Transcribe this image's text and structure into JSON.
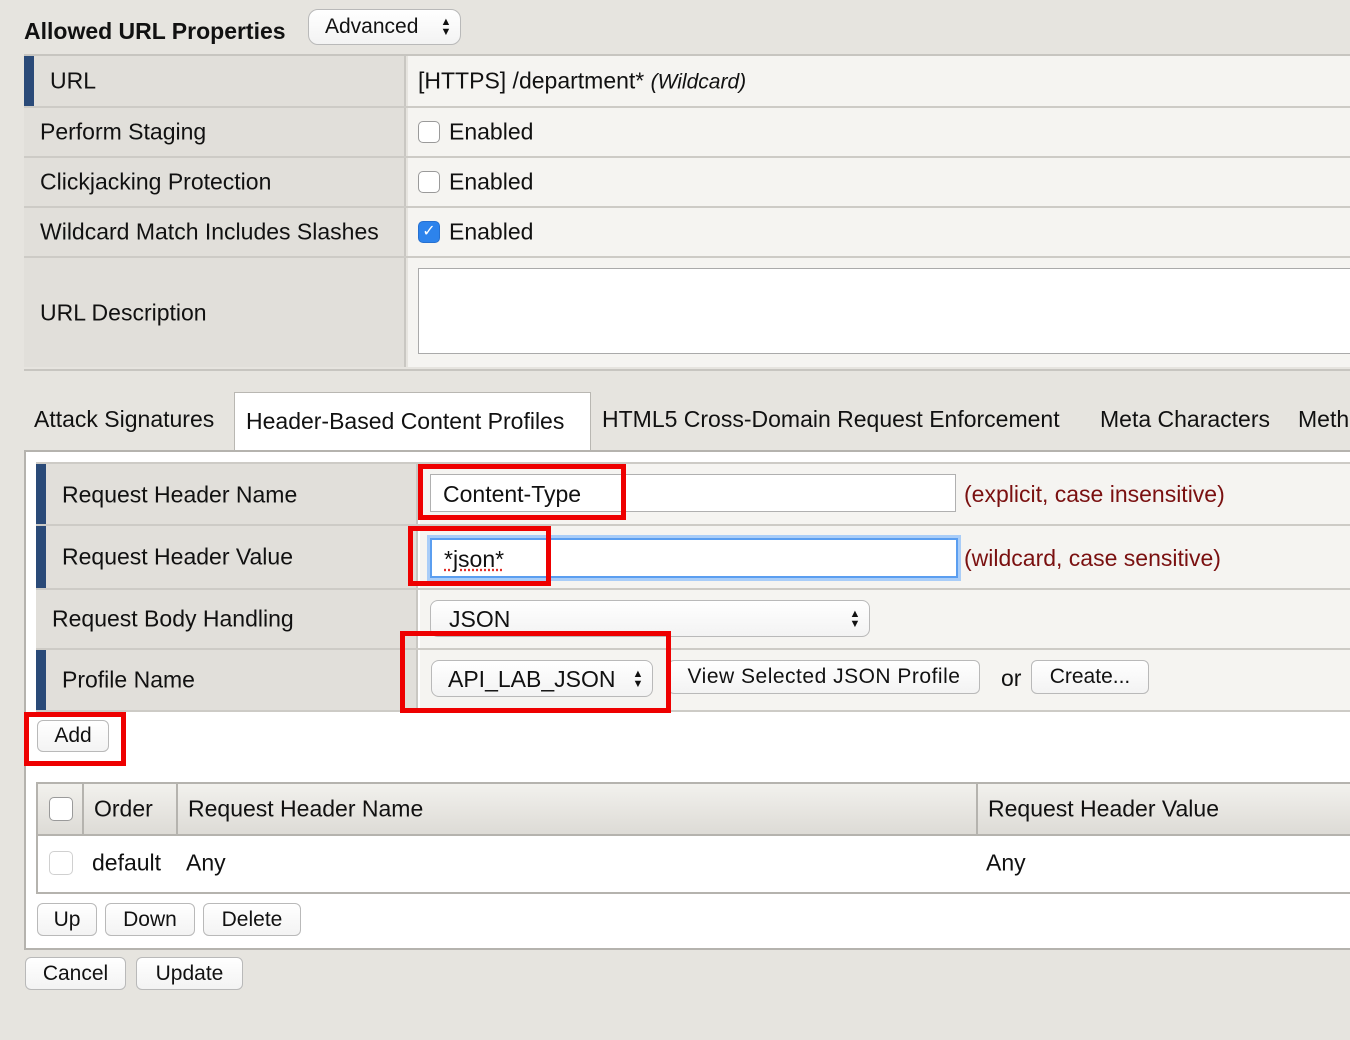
{
  "header": {
    "title": "Allowed URL Properties",
    "mode_select": "Advanced"
  },
  "properties": [
    {
      "label": "URL",
      "value": "[HTTPS] /department*",
      "value_note": "(Wildcard)"
    },
    {
      "label": "Perform Staging",
      "checkbox_label": "Enabled",
      "checked": false
    },
    {
      "label": "Clickjacking Protection",
      "checkbox_label": "Enabled",
      "checked": false
    },
    {
      "label": "Wildcard Match Includes Slashes",
      "checkbox_label": "Enabled",
      "checked": true
    },
    {
      "label": "URL Description",
      "value": ""
    }
  ],
  "tabs": [
    {
      "label": "Attack Signatures",
      "active": false
    },
    {
      "label": "Header-Based Content Profiles",
      "active": true
    },
    {
      "label": "HTML5 Cross-Domain Request Enforcement",
      "active": false
    },
    {
      "label": "Meta Characters",
      "active": false
    },
    {
      "label": "Meth",
      "active": false
    }
  ],
  "form": {
    "header_name_label": "Request Header Name",
    "header_name_value": "Content-Type",
    "header_name_hint": "(explicit, case insensitive)",
    "header_value_label": "Request Header Value",
    "header_value_value": "*json*",
    "header_value_hint": "(wildcard, case sensitive)",
    "body_handling_label": "Request Body Handling",
    "body_handling_value": "JSON",
    "profile_label": "Profile Name",
    "profile_value": "API_LAB_JSON",
    "view_profile_button": "View Selected JSON Profile",
    "or_text": "or",
    "create_button": "Create...",
    "add_button": "Add"
  },
  "list": {
    "columns": [
      "Order",
      "Request Header Name",
      "Request Header Value"
    ],
    "rows": [
      {
        "order": "default",
        "name": "Any",
        "value": "Any"
      }
    ],
    "up_button": "Up",
    "down_button": "Down",
    "delete_button": "Delete"
  },
  "footer": {
    "cancel_button": "Cancel",
    "update_button": "Update"
  },
  "colors": {
    "accent_bar": "#2a4a78",
    "highlight": "#ee0000",
    "hint_text": "#7a1010",
    "checkbox_on": "#2d83ec"
  }
}
